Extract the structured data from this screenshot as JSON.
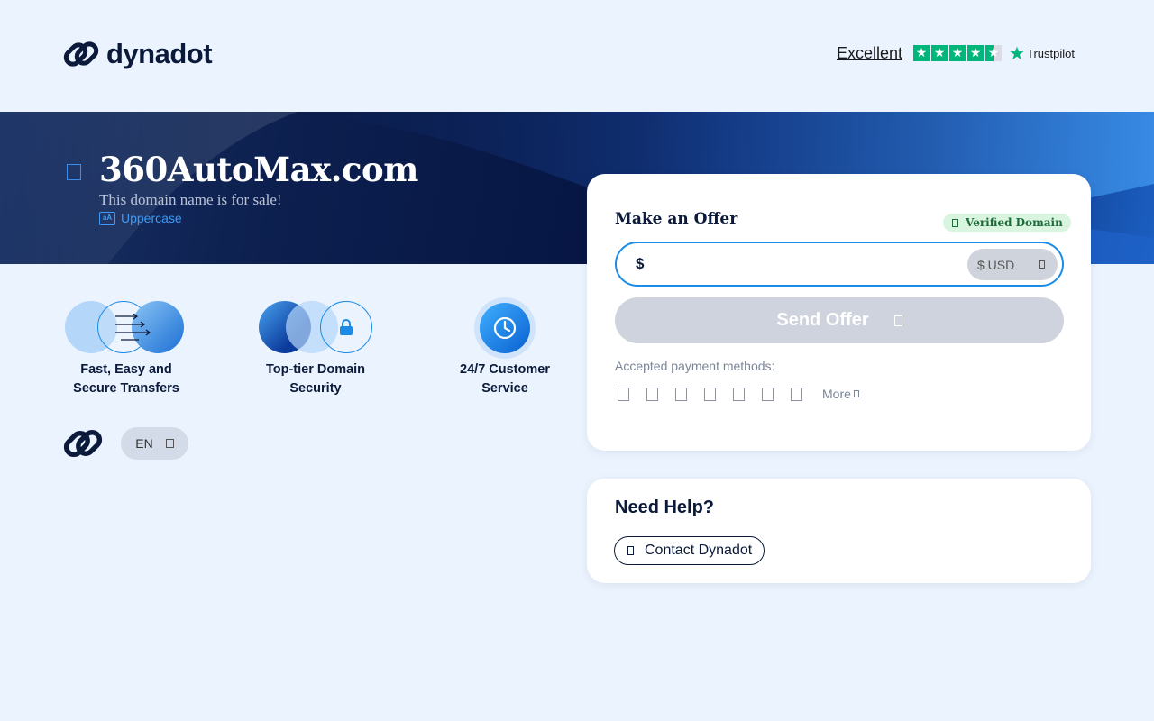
{
  "header": {
    "brand": "dynadot",
    "trust_rating": "Excellent",
    "trust_stars": 4.5,
    "trust_brand": "Trustpilot"
  },
  "hero": {
    "domain": "360AutoMax.com",
    "subtitle": "This domain name is for sale!",
    "case_toggle_icon": "aA",
    "case_toggle": "Uppercase"
  },
  "features": [
    {
      "label_line1": "Fast, Easy and",
      "label_line2": "Secure Transfers",
      "icon": "transfer-icon"
    },
    {
      "label_line1": "Top-tier Domain",
      "label_line2": "Security",
      "icon": "lock-icon"
    },
    {
      "label_line1": "24/7 Customer",
      "label_line2": "Service",
      "icon": "clock-icon"
    }
  ],
  "language": {
    "selected": "EN"
  },
  "offer": {
    "title": "Make an Offer",
    "verified_badge": "Verified Domain",
    "currency_symbol": "$",
    "amount_value": "",
    "currency": "$ USD",
    "send_label": "Send Offer",
    "payment_label": "Accepted payment methods:",
    "payment_methods": [
      "card-icon",
      "paypal-icon",
      "visa-icon",
      "mastercard-icon",
      "amex-icon",
      "bank-icon",
      "crypto-icon"
    ],
    "more_label": "More"
  },
  "help": {
    "title": "Need Help?",
    "contact_label": "Contact Dynadot"
  },
  "colors": {
    "accent": "#1a8ce8",
    "navy": "#0b1a3a",
    "trustpilot_green": "#00b67a",
    "page_bg": "#ebf3fe"
  }
}
